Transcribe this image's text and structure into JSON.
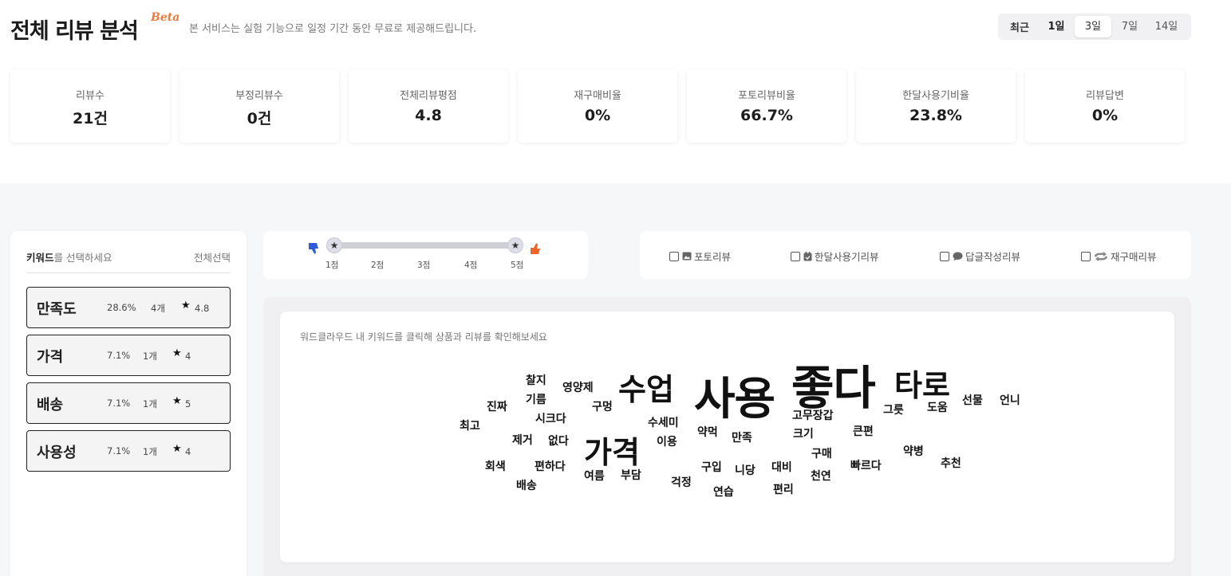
{
  "header": {
    "title": "전체 리뷰 분석",
    "beta": "Beta",
    "subtitle": "본 서비스는 실험 기능으로 일정 기간 동안 무료로 제공해드립니다."
  },
  "period": {
    "label": "최근",
    "options": [
      "1일",
      "3일",
      "7일",
      "14일"
    ],
    "selected": "3일"
  },
  "stats": [
    {
      "label": "리뷰수",
      "value": "21건"
    },
    {
      "label": "부정리뷰수",
      "value": "0건"
    },
    {
      "label": "전체리뷰평점",
      "value": "4.8"
    },
    {
      "label": "재구매비율",
      "value": "0%"
    },
    {
      "label": "포토리뷰비율",
      "value": "66.7%"
    },
    {
      "label": "한달사용기비율",
      "value": "23.8%"
    },
    {
      "label": "리뷰답변",
      "value": "0%"
    }
  ],
  "keywords": {
    "prompt_bold": "키워드",
    "prompt_rest": "를 선택하세요",
    "select_all": "전체선택",
    "items": [
      {
        "name": "만족도",
        "percent": "28.6%",
        "count": "4개",
        "rating": "4.8"
      },
      {
        "name": "가격",
        "percent": "7.1%",
        "count": "1개",
        "rating": "4"
      },
      {
        "name": "배송",
        "percent": "7.1%",
        "count": "1개",
        "rating": "5"
      },
      {
        "name": "사용성",
        "percent": "7.1%",
        "count": "1개",
        "rating": "4"
      }
    ]
  },
  "rating_slider": {
    "ticks": [
      "1점",
      "2점",
      "3점",
      "4점",
      "5점"
    ],
    "range": [
      1,
      5
    ]
  },
  "filters": [
    "포토리뷰",
    "한달사용기리뷰",
    "답글작성리뷰",
    "재구매리뷰"
  ],
  "cloud": {
    "hint": "워드클라우드 내 키워드를 클릭해 상품과 리뷰를 확인해보세요",
    "words": [
      "좋다",
      "사용",
      "타로",
      "수업",
      "가격",
      "찰지",
      "기름",
      "영양제",
      "구멍",
      "진짜",
      "시크다",
      "최고",
      "제거",
      "없다",
      "수세미",
      "이용",
      "약먹",
      "만족",
      "고무장갑",
      "크기",
      "큰편",
      "그릇",
      "도움",
      "선물",
      "언니",
      "회색",
      "편하다",
      "배송",
      "여름",
      "부담",
      "걱정",
      "구입",
      "니당",
      "연습",
      "대비",
      "편리",
      "구매",
      "천연",
      "빠르다",
      "약병",
      "추천"
    ]
  },
  "colors": {
    "beta": "#ee7a3b",
    "thumb_down": "#2e5bd8",
    "thumb_up": "#f0652a",
    "panel_bg": "#f6f7f9"
  }
}
